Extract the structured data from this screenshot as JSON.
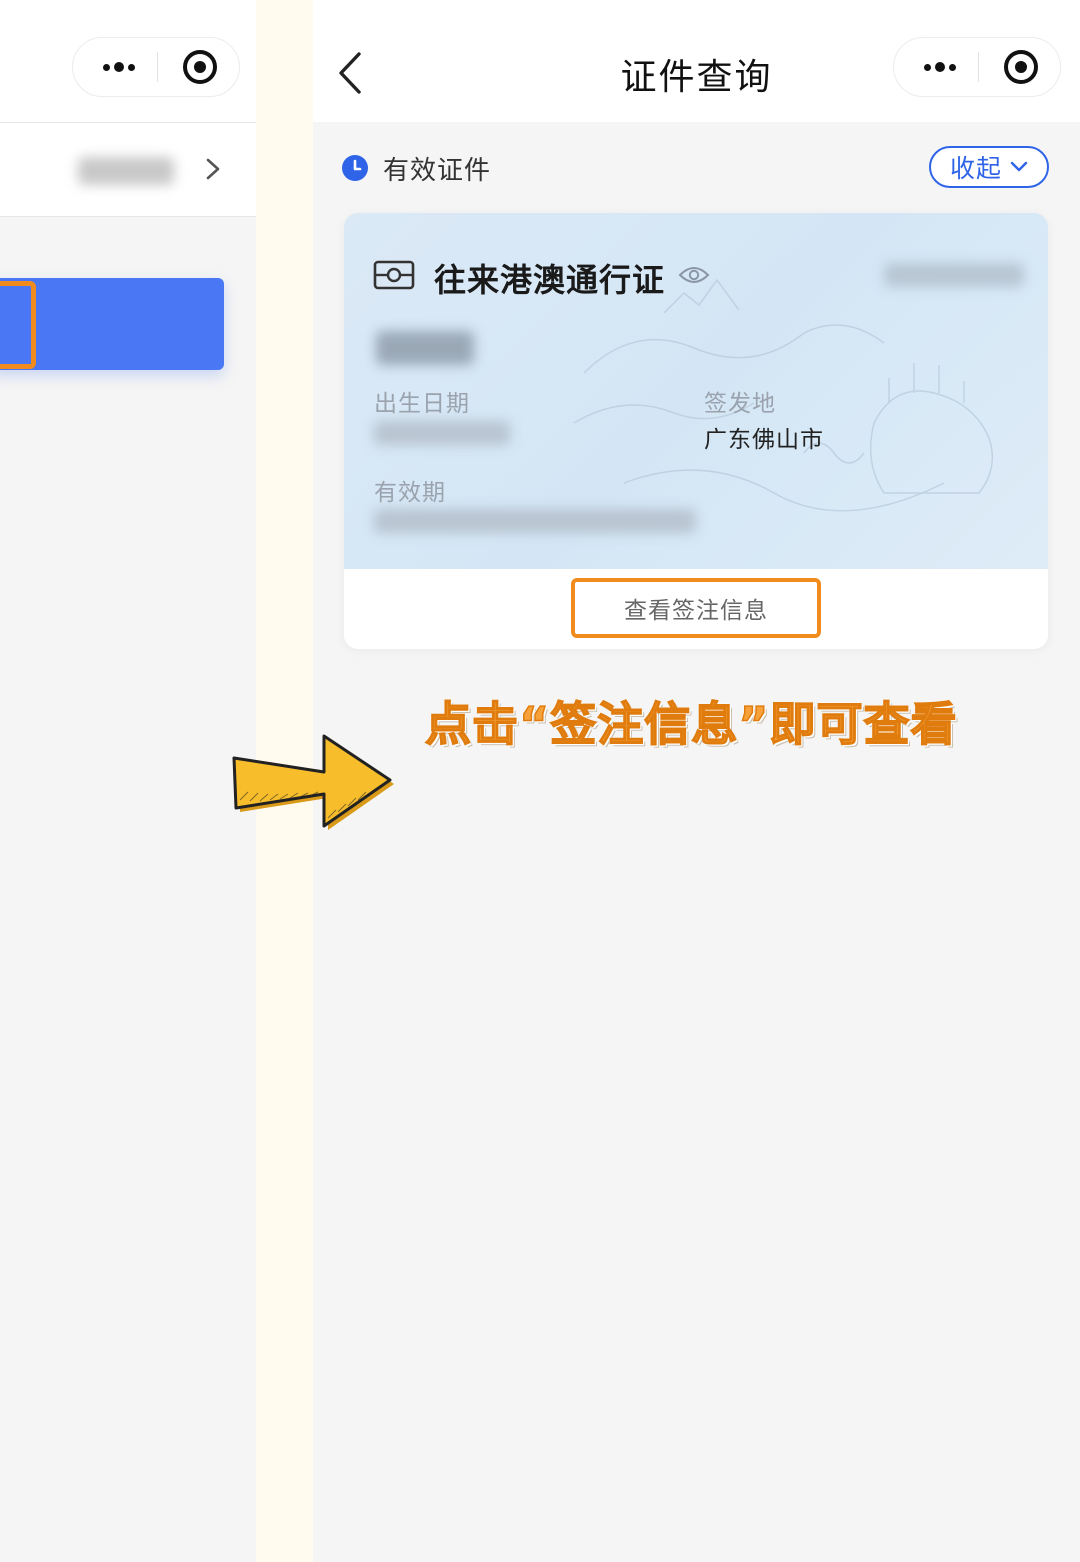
{
  "left_panel": {
    "capsule": {
      "more_icon": "more-dots-icon",
      "close_icon": "target-icon"
    },
    "row": {
      "chevron_icon": "chevron-right-icon"
    }
  },
  "right_panel": {
    "nav": {
      "title": "证件查询",
      "back_icon": "chevron-left-icon",
      "capsule": {
        "more_icon": "more-dots-icon",
        "close_icon": "target-icon"
      }
    },
    "section": {
      "title": "有效证件",
      "icon": "clock-icon",
      "collapse_label": "收起",
      "collapse_icon": "chevron-down-icon"
    },
    "card": {
      "title": "往来港澳通行证",
      "pass_icon": "id-card-icon",
      "eye_icon": "eye-icon",
      "fields": {
        "birth_label": "出生日期",
        "issue_place_label": "签发地",
        "issue_place_value": "广东佛山市",
        "validity_label": "有效期"
      },
      "view_visa_label": "查看签注信息"
    }
  },
  "annotation": {
    "callout": "点击“签注信息”即可查看",
    "arrow_color": "#f7bd2b",
    "highlight_color": "#f28b1e"
  },
  "colors": {
    "accent_blue": "#2f64e8",
    "left_button_blue": "#4a78f5",
    "background": "#f5f5f5"
  }
}
